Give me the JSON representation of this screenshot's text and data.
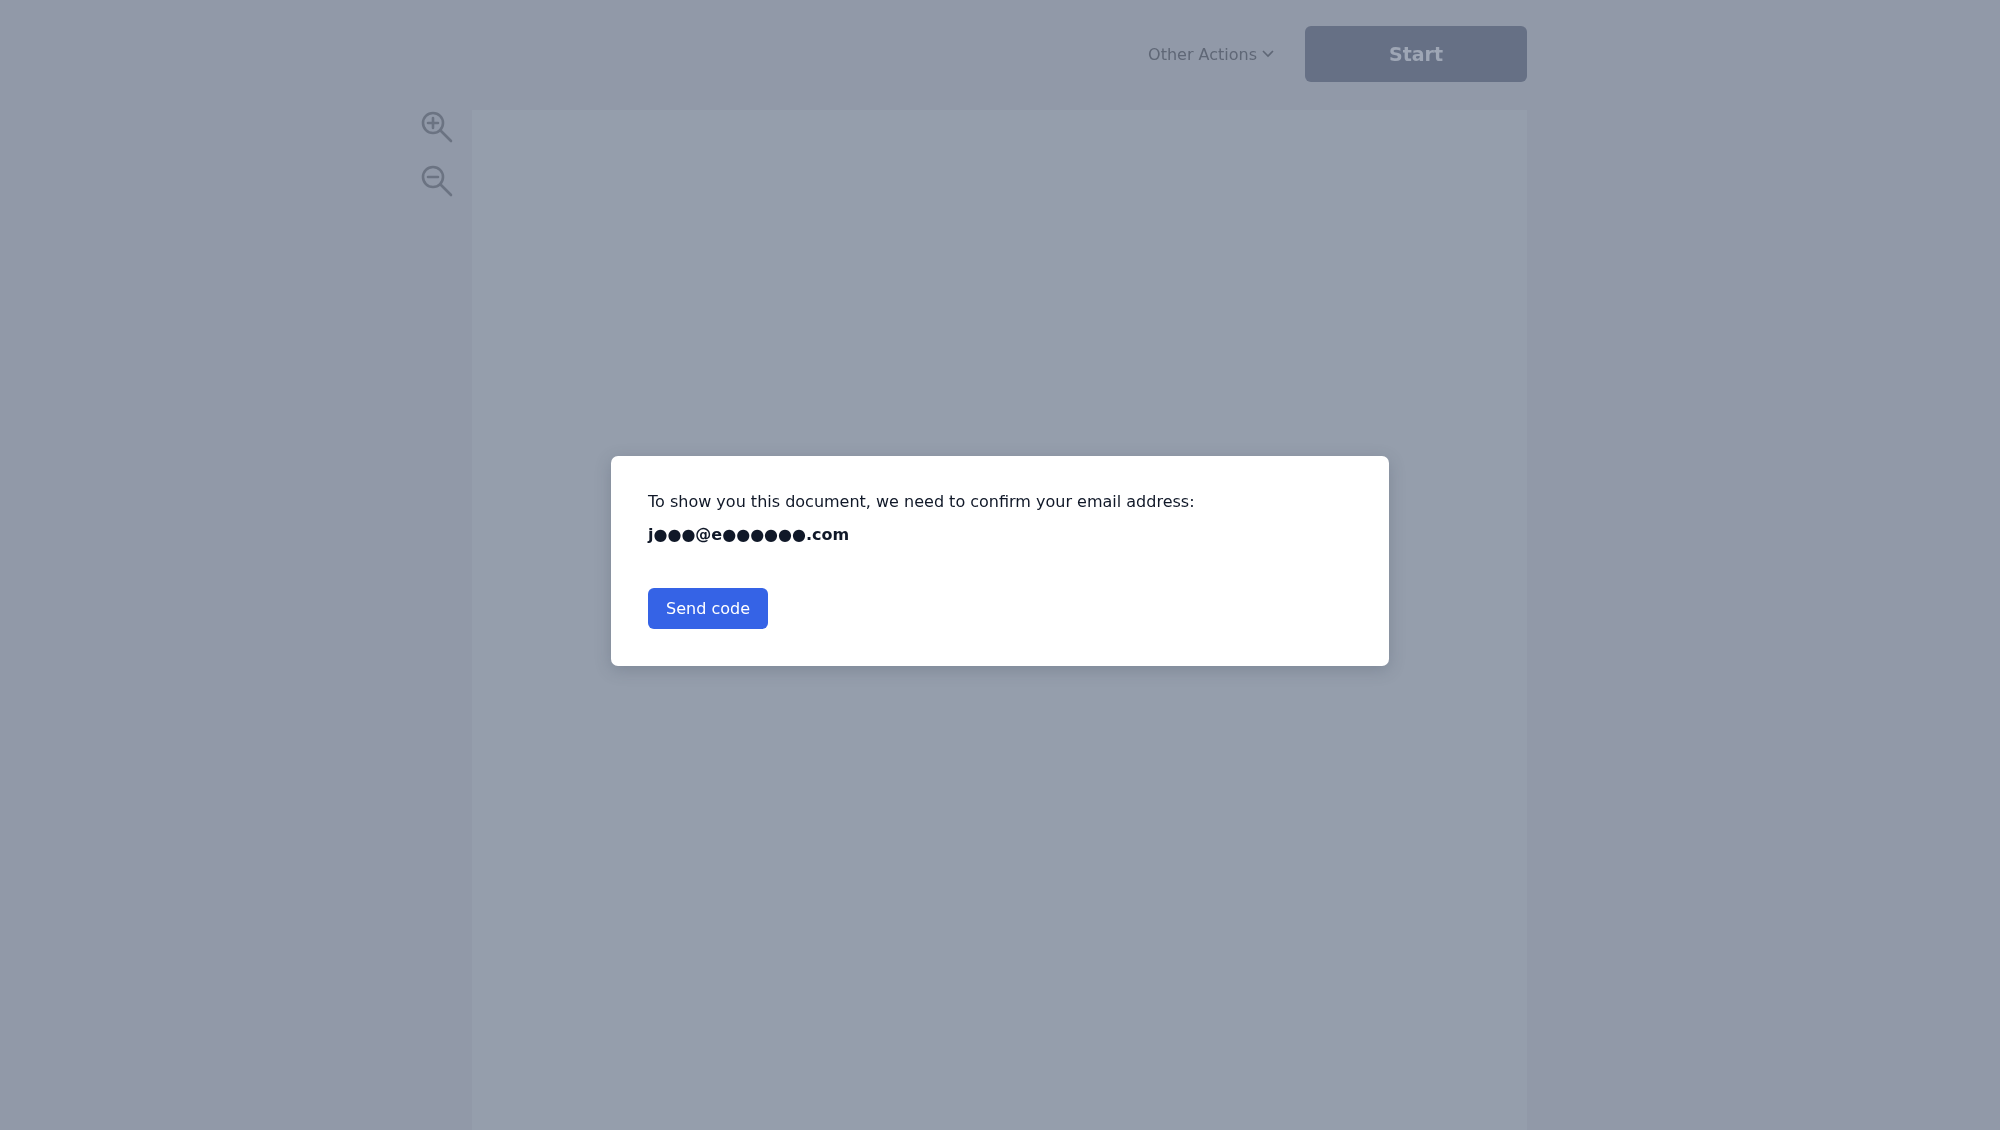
{
  "toolbar": {
    "other_actions": "Other Actions",
    "start_button": "Start"
  },
  "dialog": {
    "message": "To show you this document, we need to confirm your email address:",
    "email": "j●●●@e●●●●●●.com",
    "button": "Send code"
  }
}
